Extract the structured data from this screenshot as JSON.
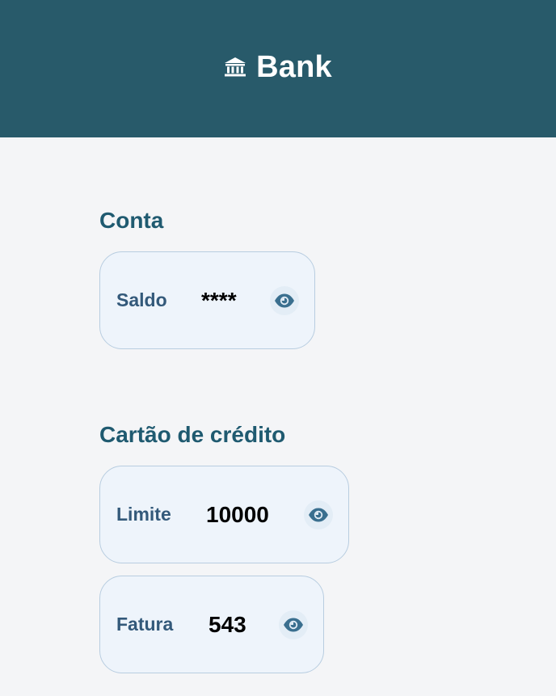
{
  "header": {
    "title": "Bank",
    "icon": "bank-icon"
  },
  "conta": {
    "title": "Conta",
    "saldo": {
      "label": "Saldo",
      "value": "****",
      "toggle_icon": "eye-icon"
    }
  },
  "cartao": {
    "title": "Cartão de crédito",
    "limite": {
      "label": "Limite",
      "value": "10000",
      "toggle_icon": "eye-icon"
    },
    "fatura": {
      "label": "Fatura",
      "value": "543",
      "toggle_icon": "eye-icon"
    }
  },
  "colors": {
    "header_bg": "#285a6a",
    "section_title": "#1f5a70",
    "card_bg": "#eef4fb",
    "card_border": "#b8cde0",
    "label": "#33597a",
    "icon": "#3a6f8f"
  }
}
